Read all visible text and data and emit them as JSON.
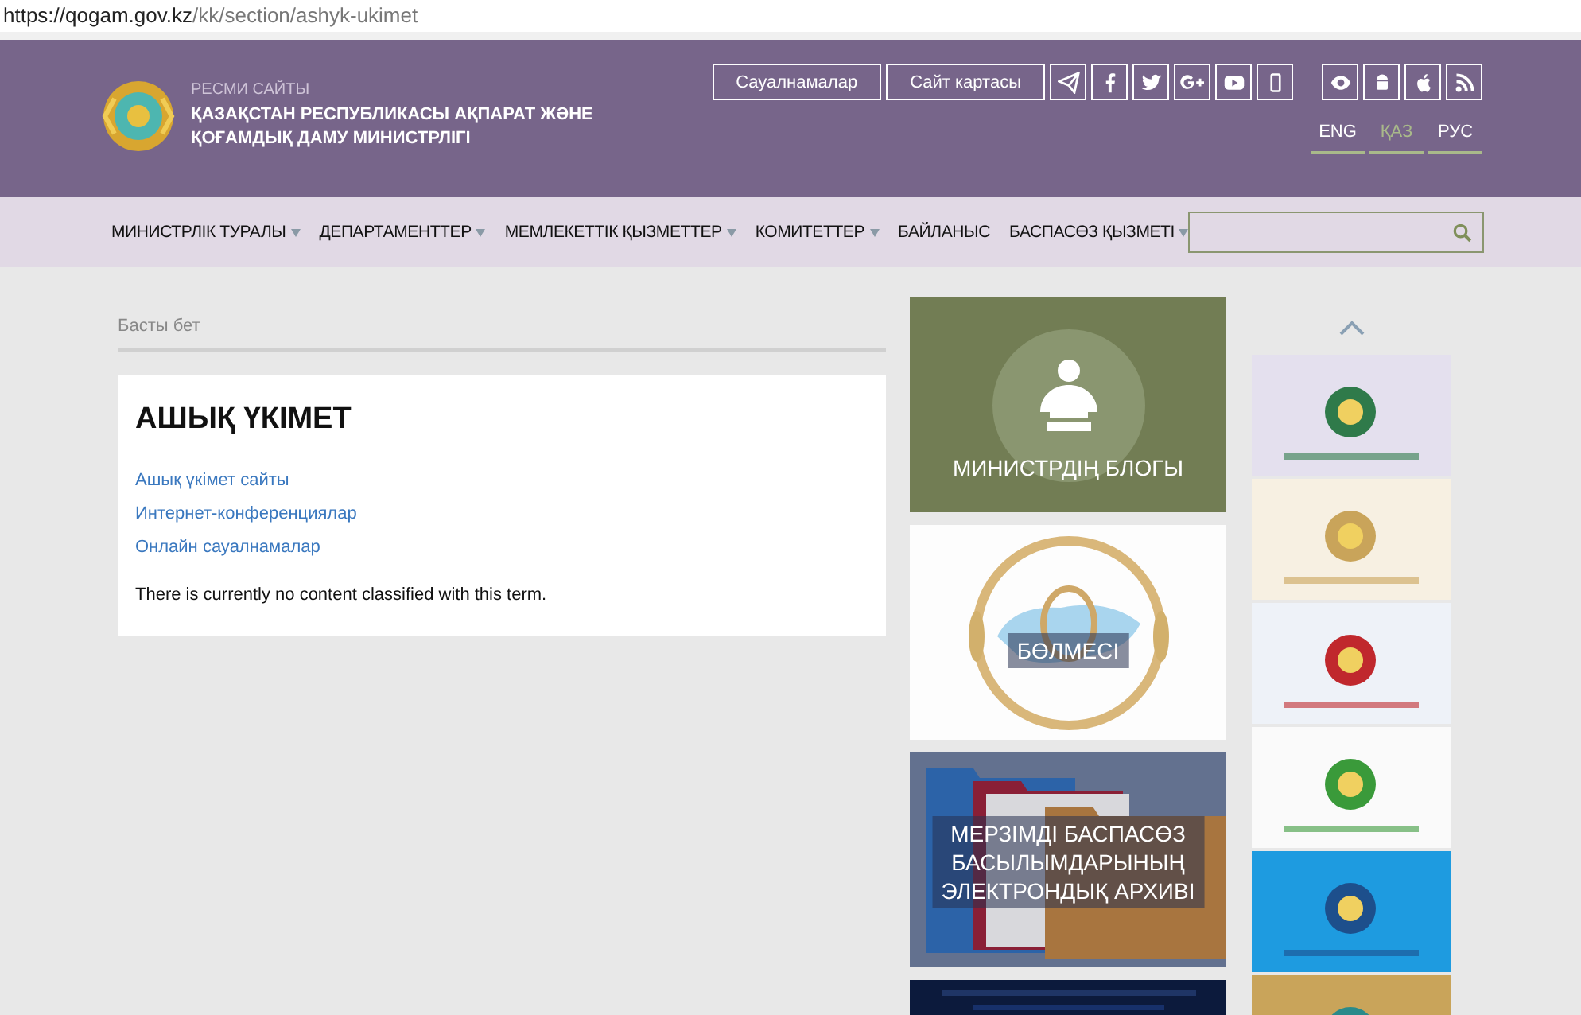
{
  "address_bar": {
    "host": "https://qogam.gov.kz",
    "path": "/kk/section/ashyk-ukimet"
  },
  "header": {
    "label": "РЕСМИ САЙТЫ",
    "title_lines": [
      "ҚАЗАҚСТАН РЕСПУБЛИКАСЫ АҚПАРАТ ЖӘНЕ",
      "ҚОҒАМДЫҚ ДАМУ МИНИСТРЛІГІ"
    ],
    "buttons": [
      "Сауалнамалар",
      "Сайт картасы"
    ],
    "languages": [
      {
        "label": "ENG",
        "selected": false
      },
      {
        "label": "ҚАЗ",
        "selected": true
      },
      {
        "label": "РУС",
        "selected": false
      }
    ]
  },
  "nav": {
    "items": [
      {
        "label": "МИНИСТРЛІК ТУРАЛЫ",
        "dropdown": true
      },
      {
        "label": "ДЕПАРТАМЕНТТЕР",
        "dropdown": true
      },
      {
        "label": "МЕМЛЕКЕТТІК ҚЫЗМЕТТЕР",
        "dropdown": true
      },
      {
        "label": "КОМИТЕТТЕР",
        "dropdown": true
      },
      {
        "label": "БАЙЛАНЫС",
        "dropdown": false
      },
      {
        "label": "БАСПАСӨЗ ҚЫЗМЕТІ",
        "dropdown": true
      }
    ]
  },
  "breadcrumb": "Басты бет",
  "content": {
    "title": "АШЫҚ ҮКІМЕТ",
    "links": [
      "Ашық үкімет сайты",
      "Интернет-конференциялар",
      "Онлайн сауалнамалар"
    ],
    "note": "There is currently no content classified with this term."
  },
  "tiles": [
    {
      "kind": "blog",
      "title_lines": [
        "МИНИСТРДІҢ БЛОГЫ"
      ]
    },
    {
      "kind": "emblem",
      "title_lines": [
        "БӨЛМЕСІ"
      ]
    },
    {
      "kind": "folders",
      "title_lines": [
        "МЕРЗІМДІ БАСПАСӨЗ",
        "БАСЫЛЫМДАРЫНЫҢ",
        "ЭЛЕКТРОНДЫҚ АРХИВІ"
      ]
    },
    {
      "kind": "dark"
    }
  ]
}
